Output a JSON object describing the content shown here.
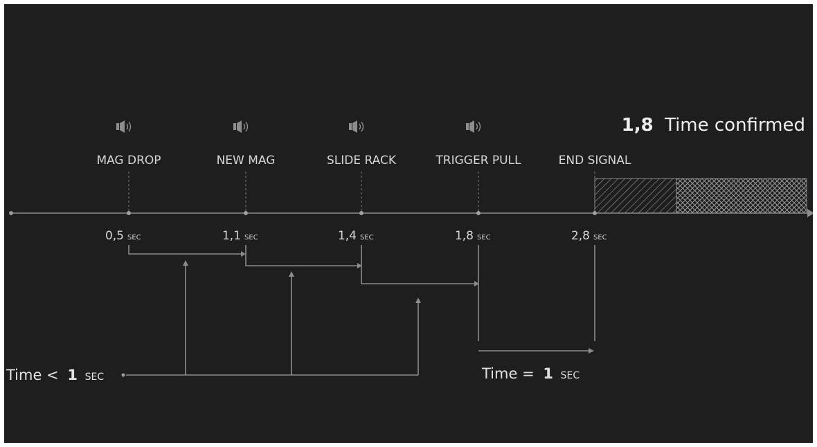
{
  "events": [
    {
      "label": "MAG DROP",
      "time": "0,5",
      "unit": "SEC",
      "icon": "speaker-icon"
    },
    {
      "label": "NEW MAG",
      "time": "1,1",
      "unit": "SEC",
      "icon": "speaker-icon"
    },
    {
      "label": "SLIDE RACK",
      "time": "1,4",
      "unit": "SEC",
      "icon": "speaker-icon"
    },
    {
      "label": "TRIGGER PULL",
      "time": "1,8",
      "unit": "SEC",
      "icon": "speaker-icon"
    },
    {
      "label": "END SIGNAL",
      "time": "2,8",
      "unit": "SEC",
      "icon": null
    }
  ],
  "confirmed": {
    "value": "1,8",
    "text": "Time confirmed"
  },
  "left_note": {
    "prefix": "Time <",
    "value": "1",
    "unit": "SEC"
  },
  "right_note": {
    "prefix": "Time =",
    "value": "1",
    "unit": "SEC"
  },
  "colors": {
    "background": "#1e1e1e",
    "line": "#8c8c8c",
    "text": "#d6d6d6"
  }
}
